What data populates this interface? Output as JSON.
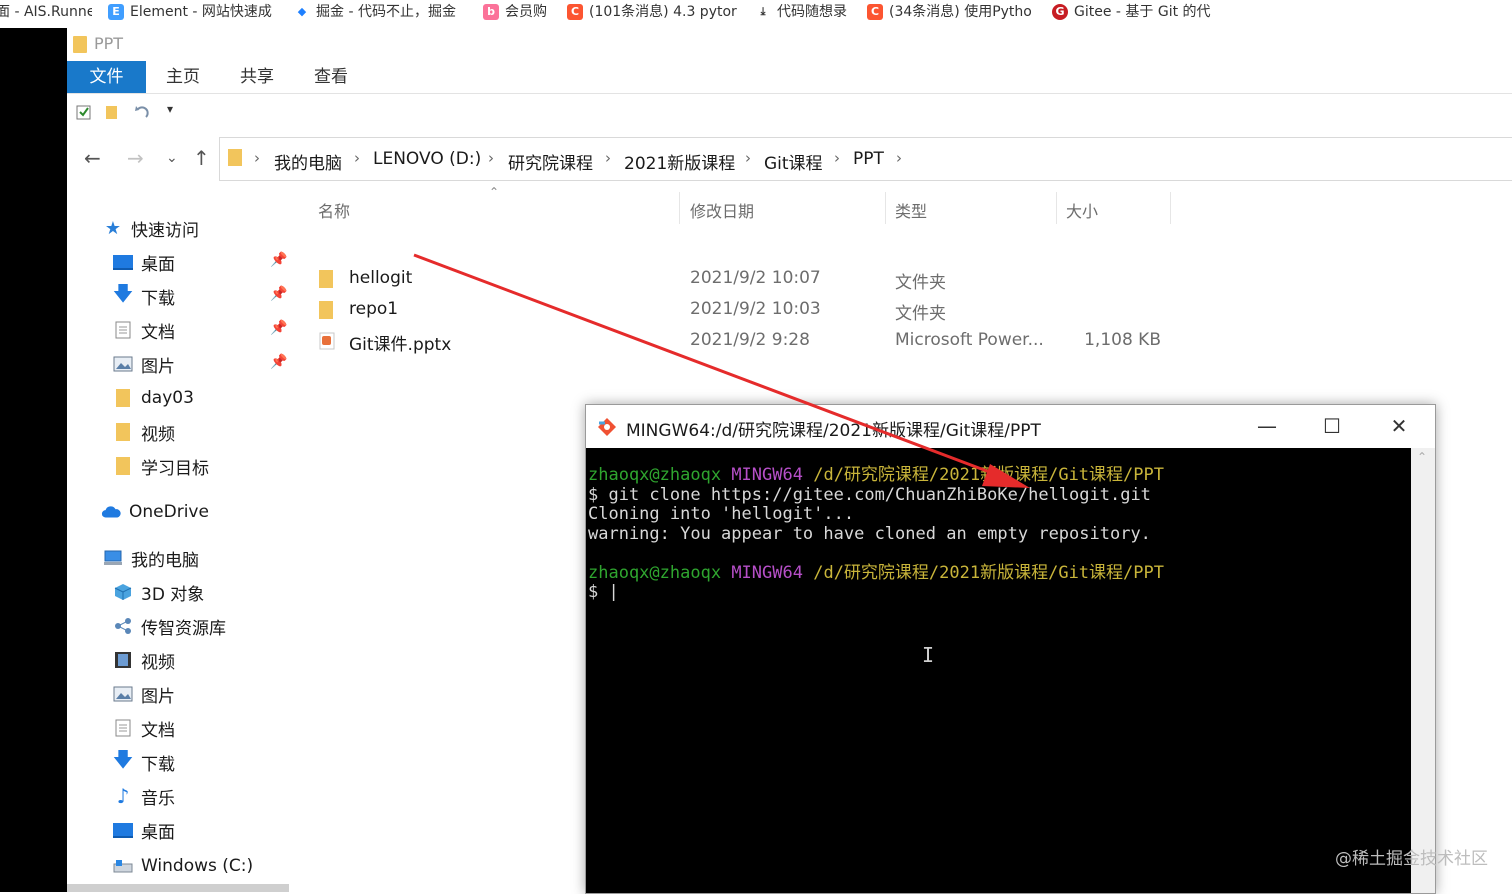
{
  "bookmarks": [
    {
      "label": "面 - AIS.Runne",
      "icon": "ais-icon",
      "color": "#3b6fb6"
    },
    {
      "label": "Element - 网站快速成",
      "icon": "element-icon",
      "color": "#409eff"
    },
    {
      "label": "掘金 - 代码不止，掘金",
      "icon": "juejin-icon",
      "color": "#1e80ff"
    },
    {
      "label": "会员购",
      "icon": "bilibili-icon",
      "color": "#fb7299"
    },
    {
      "label": "(101条消息) 4.3 pytor",
      "icon": "csdn-icon",
      "color": "#fc5531"
    },
    {
      "label": "代码随想录",
      "icon": "daima-icon",
      "color": "#333333"
    },
    {
      "label": "(34条消息) 使用Pytho",
      "icon": "csdn-icon",
      "color": "#fc5531"
    },
    {
      "label": "Gitee - 基于 Git 的代",
      "icon": "gitee-icon",
      "color": "#c71d23"
    }
  ],
  "explorer": {
    "title": "PPT",
    "ribbon_tabs": [
      "文件",
      "主页",
      "共享",
      "查看"
    ],
    "breadcrumb": [
      "我的电脑",
      "LENOVO (D:)",
      "研究院课程",
      "2021新版课程",
      "Git课程",
      "PPT"
    ],
    "nav": {
      "quick_access": "快速访问",
      "quick_items": [
        {
          "label": "桌面",
          "icon": "desktop-icon",
          "pinned": true
        },
        {
          "label": "下载",
          "icon": "download-icon",
          "pinned": true
        },
        {
          "label": "文档",
          "icon": "document-icon",
          "pinned": true
        },
        {
          "label": "图片",
          "icon": "picture-icon",
          "pinned": true
        },
        {
          "label": "day03",
          "icon": "folder-icon",
          "pinned": false
        },
        {
          "label": "视频",
          "icon": "folder-icon",
          "pinned": false
        },
        {
          "label": "学习目标",
          "icon": "folder-icon",
          "pinned": false
        }
      ],
      "onedrive": "OneDrive",
      "this_pc": "我的电脑",
      "pc_items": [
        {
          "label": "3D 对象",
          "icon": "3d-objects-icon"
        },
        {
          "label": "传智资源库",
          "icon": "network-share-icon"
        },
        {
          "label": "视频",
          "icon": "video-icon"
        },
        {
          "label": "图片",
          "icon": "picture-icon"
        },
        {
          "label": "文档",
          "icon": "document-icon"
        },
        {
          "label": "下载",
          "icon": "download-icon"
        },
        {
          "label": "音乐",
          "icon": "music-icon"
        },
        {
          "label": "桌面",
          "icon": "desktop-icon"
        },
        {
          "label": "Windows (C:)",
          "icon": "drive-icon"
        }
      ]
    },
    "columns": [
      "名称",
      "修改日期",
      "类型",
      "大小"
    ],
    "files": [
      {
        "name": "hellogit",
        "date": "2021/9/2 10:07",
        "type": "文件夹",
        "size": "",
        "icon": "folder-icon"
      },
      {
        "name": "repo1",
        "date": "2021/9/2 10:03",
        "type": "文件夹",
        "size": "",
        "icon": "folder-icon"
      },
      {
        "name": "Git课件.pptx",
        "date": "2021/9/2 9:28",
        "type": "Microsoft Power...",
        "size": "1,108 KB",
        "icon": "pptx-icon"
      }
    ]
  },
  "terminal": {
    "title": "MINGW64:/d/研究院课程/2021新版课程/Git课程/PPT",
    "lines": [
      {
        "user": "zhaoqx@zhaoqx",
        "env": "MINGW64",
        "path": "/d/研究院课程/2021新版课程/Git课程/PPT"
      },
      {
        "text": "$ git clone https://gitee.com/ChuanZhiBoKe/hellogit.git"
      },
      {
        "text": "Cloning into 'hellogit'..."
      },
      {
        "text": "warning: You appear to have cloned an empty repository."
      },
      {
        "text": ""
      },
      {
        "user": "zhaoqx@zhaoqx",
        "env": "MINGW64",
        "path": "/d/研究院课程/2021新版课程/Git课程/PPT"
      },
      {
        "text": "$ |"
      }
    ]
  },
  "watermark": "@稀土掘金技术社区",
  "colors": {
    "accent": "#1979ca",
    "annotation_arrow": "#e52b2b",
    "folder": "#f2c55c"
  }
}
